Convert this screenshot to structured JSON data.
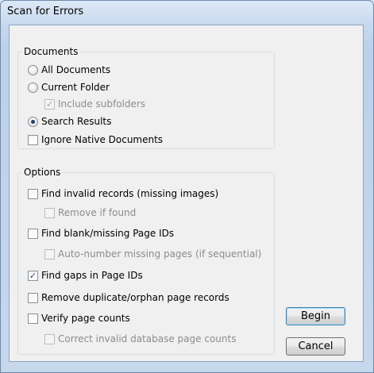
{
  "window": {
    "title": "Scan for Errors"
  },
  "documents_group": {
    "title": "Documents",
    "all_documents": {
      "label": "All Documents",
      "checked": false
    },
    "current_folder": {
      "label": "Current Folder",
      "checked": false
    },
    "include_subfolders": {
      "label": "Include subfolders",
      "checked": true,
      "enabled": false
    },
    "search_results": {
      "label": "Search Results",
      "checked": true
    },
    "ignore_native": {
      "label": "Ignore Native Documents",
      "checked": false
    }
  },
  "options_group": {
    "title": "Options",
    "find_invalid_records": {
      "label": "Find invalid records (missing images)",
      "checked": false
    },
    "remove_if_found": {
      "label": "Remove if found",
      "checked": false,
      "enabled": false
    },
    "find_blank_page_ids": {
      "label": "Find blank/missing Page IDs",
      "checked": false
    },
    "auto_number": {
      "label": "Auto-number missing pages (if sequential)",
      "checked": false,
      "enabled": false
    },
    "find_gaps": {
      "label": "Find gaps in Page IDs",
      "checked": true
    },
    "remove_duplicate": {
      "label": "Remove duplicate/orphan page records",
      "checked": false
    },
    "verify_page_counts": {
      "label": "Verify page counts",
      "checked": false
    },
    "correct_invalid": {
      "label": "Correct invalid database page counts",
      "checked": false,
      "enabled": false
    }
  },
  "buttons": {
    "begin": "Begin",
    "cancel": "Cancel"
  }
}
